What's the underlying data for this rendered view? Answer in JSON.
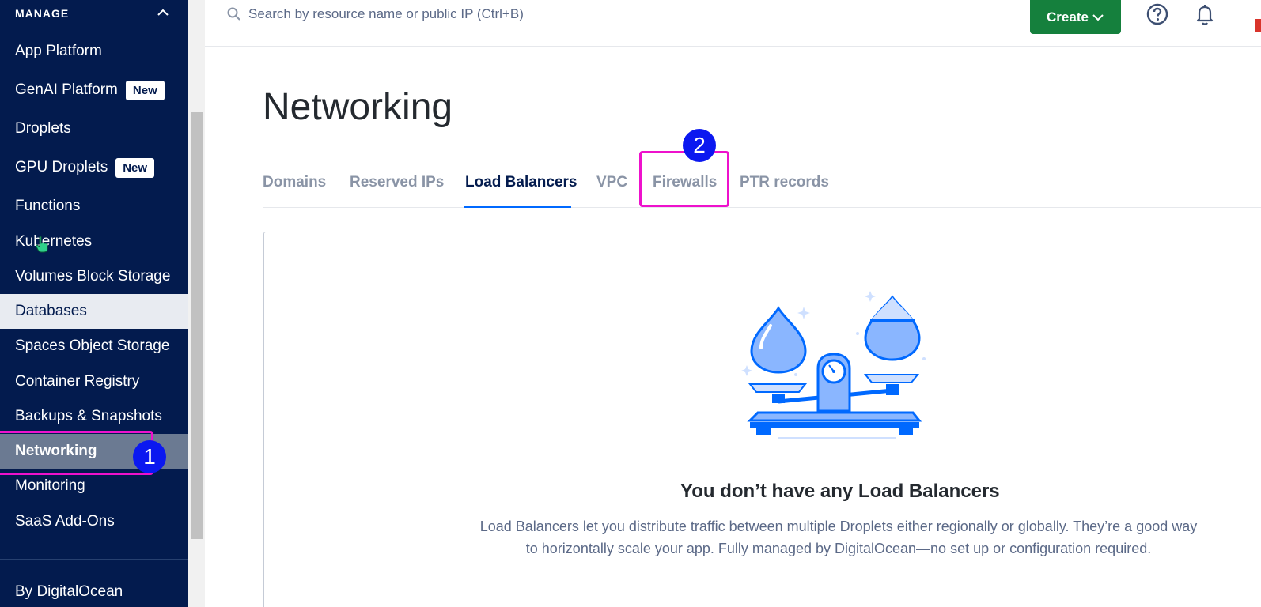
{
  "sidebar": {
    "header": "MANAGE",
    "items": [
      {
        "label": "App Platform",
        "badge": ""
      },
      {
        "label": "GenAI Platform",
        "badge": "New"
      },
      {
        "label": "Droplets",
        "badge": ""
      },
      {
        "label": "GPU Droplets",
        "badge": "New"
      },
      {
        "label": "Functions",
        "badge": ""
      },
      {
        "label": "Kubernetes",
        "badge": ""
      },
      {
        "label": "Volumes Block Storage",
        "badge": ""
      },
      {
        "label": "Databases",
        "badge": ""
      },
      {
        "label": "Spaces Object Storage",
        "badge": ""
      },
      {
        "label": "Container Registry",
        "badge": ""
      },
      {
        "label": "Backups & Snapshots",
        "badge": ""
      },
      {
        "label": "Networking",
        "badge": ""
      },
      {
        "label": "Monitoring",
        "badge": ""
      },
      {
        "label": "SaaS Add-Ons",
        "badge": ""
      }
    ],
    "footer": "By DigitalOcean"
  },
  "topbar": {
    "search_placeholder": "Search by resource name or public IP (Ctrl+B)",
    "create_label": "Create",
    "icons": [
      "search-icon",
      "help-icon",
      "bell-icon",
      "chevron-down-icon"
    ]
  },
  "main": {
    "title": "Networking",
    "tabs": [
      {
        "label": "Domains"
      },
      {
        "label": "Reserved IPs"
      },
      {
        "label": "Load Balancers"
      },
      {
        "label": "VPC"
      },
      {
        "label": "Firewalls"
      },
      {
        "label": "PTR records"
      }
    ],
    "active_tab": "Load Balancers",
    "empty_state": {
      "title": "You don’t have any Load Balancers",
      "description": "Load Balancers let you distribute traffic between multiple Droplets either regionally or globally. They’re a good way to horizontally scale your app. Fully managed by DigitalOcean—no set up or configuration required."
    }
  },
  "annotations": [
    {
      "number": "1"
    },
    {
      "number": "2"
    }
  ],
  "colors": {
    "sidebar_bg": "#031b4e",
    "active_item_bg": "#6b7a92",
    "hover_item_bg": "#e8ebf1",
    "create_button": "#15803d",
    "accent": "#0069ff",
    "annotation_box": "#ee11cc",
    "annotation_badge": "#0b18f0"
  }
}
